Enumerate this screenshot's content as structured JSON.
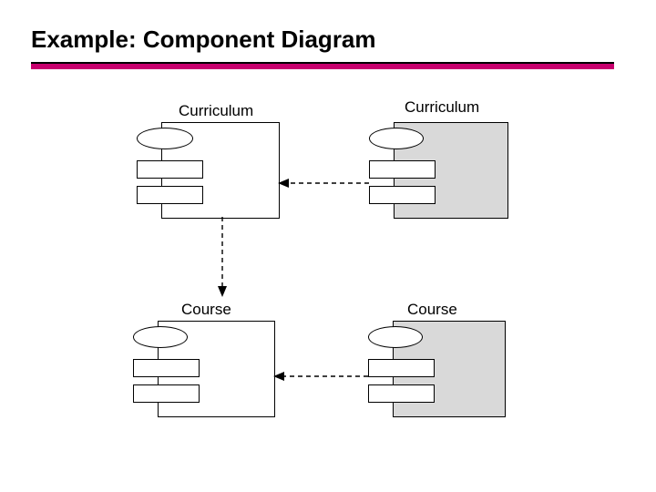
{
  "title": "Example: Component Diagram",
  "components": {
    "topLeft": "Curriculum",
    "topRight": "Curriculum",
    "bottomLeft": "Course",
    "bottomRight": "Course"
  }
}
